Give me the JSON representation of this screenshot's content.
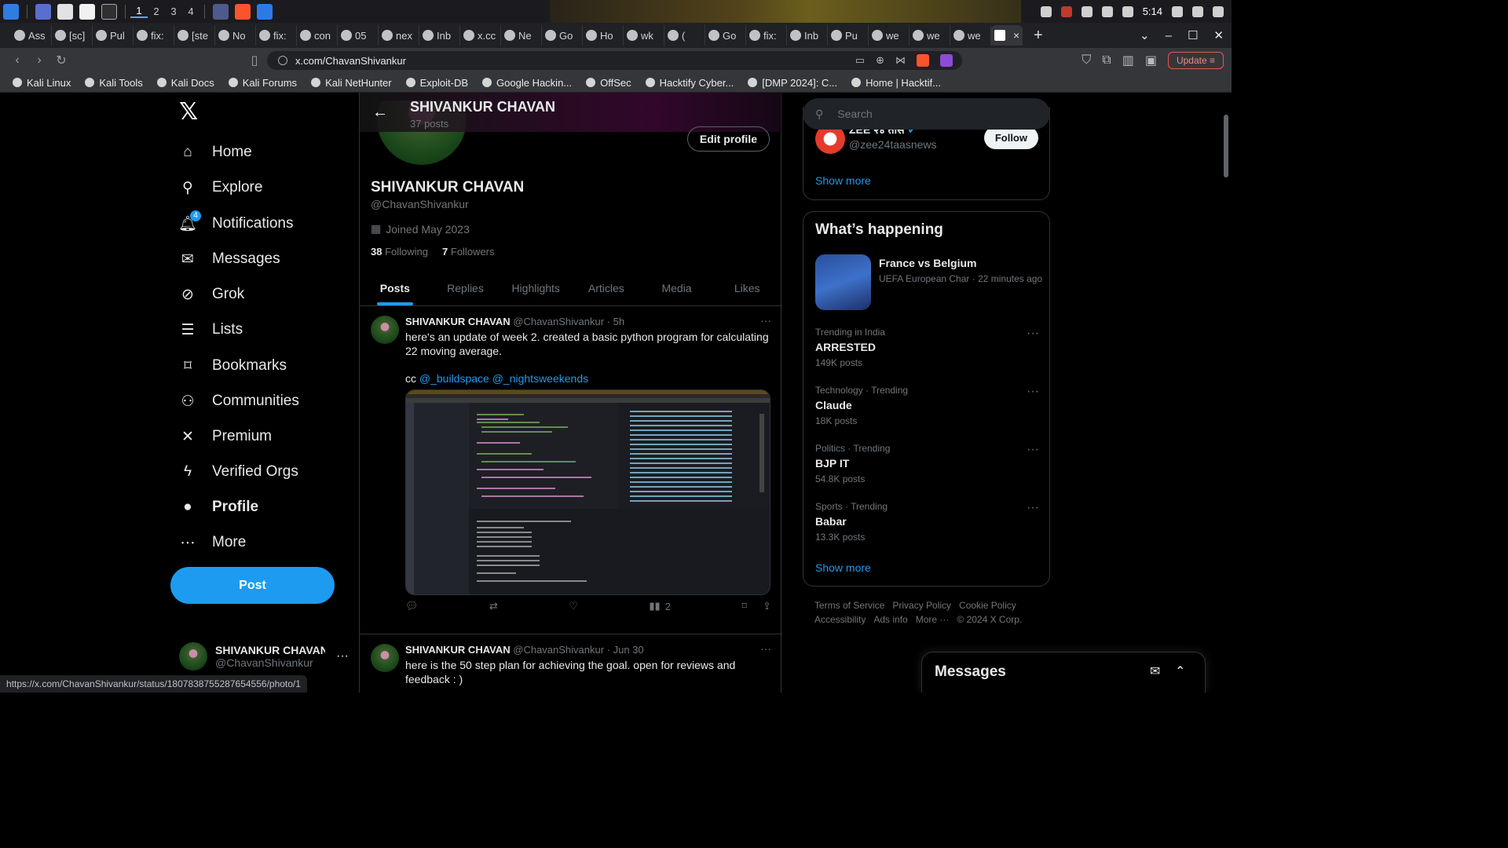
{
  "os": {
    "workspaces": [
      "1",
      "2",
      "3",
      "4"
    ],
    "clock": "5:14"
  },
  "browser": {
    "tabs": [
      "Ass",
      "[sc]",
      "Pul",
      "fix:",
      "[ste",
      "No",
      "fix:",
      "con",
      "05",
      "nex",
      "Inb",
      "x.cc",
      "Ne",
      "Go",
      "Ho",
      "wk",
      "(",
      "Go",
      "fix:",
      "Inb",
      "Pu",
      "we",
      "we",
      "we"
    ],
    "active_tab_close": "×",
    "new_tab": "+",
    "url": "x.com/ChavanShivankur",
    "update_label": "Update",
    "bookmarks": [
      "Kali Linux",
      "Kali Tools",
      "Kali Docs",
      "Kali Forums",
      "Kali NetHunter",
      "Exploit-DB",
      "Google Hackin...",
      "OffSec",
      "Hacktify Cyber...",
      "[DMP 2024]: C...",
      "Home | Hacktif..."
    ],
    "status_url": "https://x.com/ChavanShivankur/status/1807838755287654556/photo/1"
  },
  "nav": {
    "items": [
      {
        "label": "Home",
        "icon": "home-icon"
      },
      {
        "label": "Explore",
        "icon": "search-icon"
      },
      {
        "label": "Notifications",
        "icon": "bell-icon",
        "badge": "4"
      },
      {
        "label": "Messages",
        "icon": "envelope-icon"
      },
      {
        "label": "Grok",
        "icon": "grok-icon"
      },
      {
        "label": "Lists",
        "icon": "list-icon"
      },
      {
        "label": "Bookmarks",
        "icon": "bookmark-icon"
      },
      {
        "label": "Communities",
        "icon": "people-icon"
      },
      {
        "label": "Premium",
        "icon": "x-icon"
      },
      {
        "label": "Verified Orgs",
        "icon": "bolt-icon"
      },
      {
        "label": "Profile",
        "icon": "person-icon"
      },
      {
        "label": "More",
        "icon": "more-icon"
      }
    ],
    "post_label": "Post",
    "account_name": "SHIVANKUR CHAVAN",
    "account_handle": "@ChavanShivankur",
    "account_more": "···"
  },
  "profile": {
    "title": "SHIVANKUR CHAVAN",
    "posts_count": "37 posts",
    "edit_label": "Edit profile",
    "name": "SHIVANKUR CHAVAN",
    "handle": "@ChavanShivankur",
    "joined": "Joined May 2023",
    "following_count": "38",
    "following_label": "Following",
    "followers_count": "7",
    "followers_label": "Followers",
    "tabs": [
      "Posts",
      "Replies",
      "Highlights",
      "Articles",
      "Media",
      "Likes"
    ]
  },
  "tweets": [
    {
      "name": "SHIVANKUR CHAVAN",
      "meta": "@ChavanShivankur · 5h",
      "text": "here's an update of week 2. created a basic python program for calculating 22 moving average.",
      "cc": "cc",
      "mentions": "@_buildspace @_nightsweekends",
      "views": "2"
    },
    {
      "name": "SHIVANKUR CHAVAN",
      "meta": "@ChavanShivankur · Jun 30",
      "text": "here is the 50 step plan for achieving the goal. open for reviews and feedback : )"
    }
  ],
  "right": {
    "search_placeholder": "Search",
    "suggest_name": "ZEE २४ तास",
    "suggest_handle": "@zee24taasnews",
    "follow_label": "Follow",
    "show_more": "Show more",
    "happening_title": "What’s happening",
    "featured": {
      "title": "France vs Belgium",
      "meta": "UEFA European Char · 22 minutes ago"
    },
    "trends": [
      {
        "category": "Trending in India",
        "title": "ARRESTED",
        "count": "149K posts"
      },
      {
        "category": "Technology · Trending",
        "title": "Claude",
        "count": "18K posts"
      },
      {
        "category": "Politics · Trending",
        "title": "BJP IT",
        "count": "54.8K posts"
      },
      {
        "category": "Sports · Trending",
        "title": "Babar",
        "count": "13.3K posts"
      }
    ],
    "show_more_2": "Show more",
    "footer": [
      "Terms of Service",
      "Privacy Policy",
      "Cookie Policy",
      "Accessibility",
      "Ads info",
      "More ···",
      "© 2024 X Corp."
    ],
    "messages_title": "Messages"
  },
  "colors": {
    "accent": "#1d9bf0",
    "background": "#000000",
    "border": "#2f3336",
    "muted": "#71767b"
  }
}
